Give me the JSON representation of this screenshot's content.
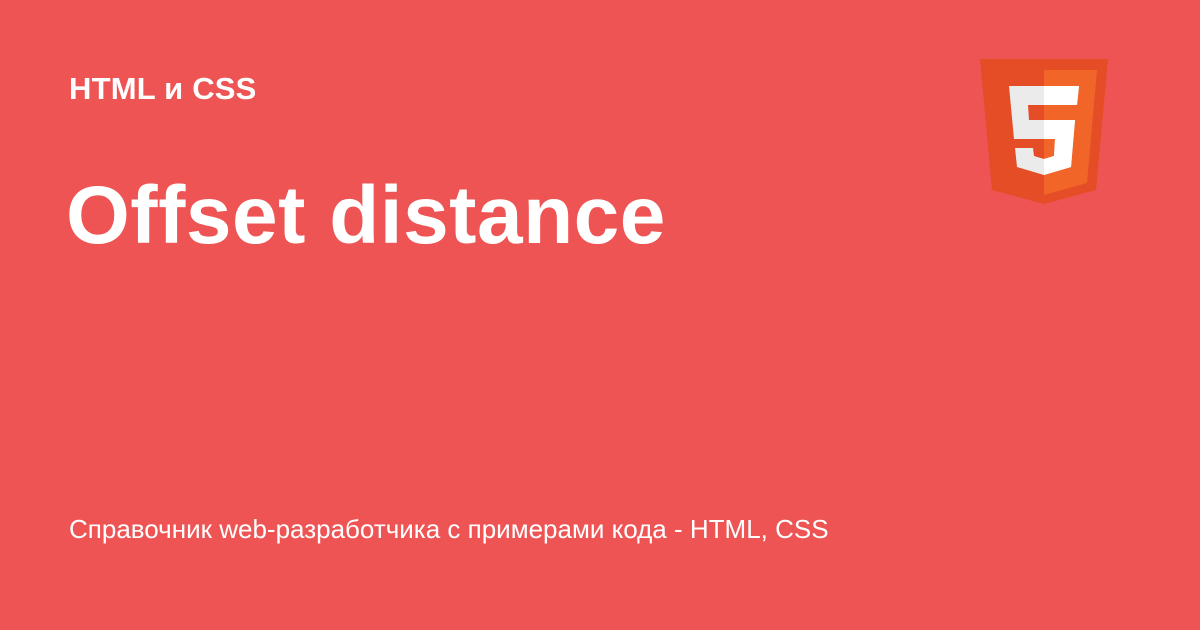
{
  "category": "HTML и CSS",
  "title": "Offset distance",
  "subtitle": "Справочник web-разработчика с примерами кода - HTML, CSS",
  "logo": {
    "icon": "html5-shield-icon",
    "glyph": "5"
  },
  "colors": {
    "background": "#ef5454",
    "text": "#ffffff",
    "logo_dark": "#e44d26",
    "logo_light": "#f16529"
  }
}
